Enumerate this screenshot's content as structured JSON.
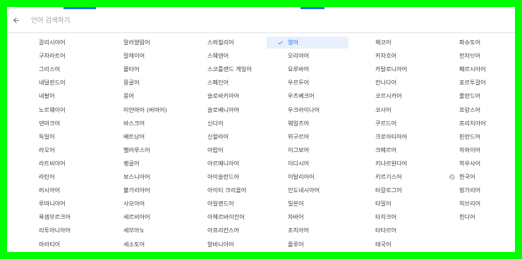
{
  "search": {
    "placeholder": "언어 검색하기"
  },
  "columns": [
    [
      "갈리시아어",
      "구자라트어",
      "그리스어",
      "네덜란드어",
      "네팔어",
      "노르웨이어",
      "덴마크어",
      "독일어",
      "라오어",
      "라트비아어",
      "라틴어",
      "러시아어",
      "루마니아어",
      "룩셈부르크어",
      "리투아니아어",
      "마라티어"
    ],
    [
      "말라얄람어",
      "말레이어",
      "몰타어",
      "몽골어",
      "몽어",
      "미얀마어 (버마어)",
      "바스크어",
      "베트남어",
      "벨라루스어",
      "벵골어",
      "보스니아어",
      "불가리아어",
      "사모아어",
      "세르비아어",
      "세부아노",
      "세소토어"
    ],
    [
      "스와힐리어",
      "스웨덴어",
      "스코틀랜드 게일어",
      "스페인어",
      "슬로바키아어",
      "슬로베니아어",
      "신디어",
      "신할라어",
      "아랍어",
      "아르메니아어",
      "아이슬란드어",
      "아이티 크리올어",
      "아일랜드어",
      "아제르바이잔어",
      "아프리칸스어",
      "알바니아어"
    ],
    [
      "영어",
      "오리야어",
      "요루바어",
      "우르두어",
      "우즈베크어",
      "우크라이나어",
      "웨일즈어",
      "위구르어",
      "이그보어",
      "이디시어",
      "이탈리아어",
      "인도네시아어",
      "일본어",
      "자바어",
      "조지아어",
      "줄루어"
    ],
    [
      "체코어",
      "카자흐어",
      "카탈로니아어",
      "칸나다어",
      "코르시카어",
      "코사어",
      "쿠르드어",
      "크로아티아어",
      "크메르어",
      "키냐르완다어",
      "키르기스어",
      "타갈로그어",
      "타밀어",
      "타지크어",
      "타타르어",
      "태국어"
    ],
    [
      "파슈토어",
      "펀자브어",
      "페르시아어",
      "포르투갈어",
      "폴란드어",
      "프랑스어",
      "프리지아어",
      "핀란드어",
      "하와이어",
      "하우사어",
      "한국어",
      "헝가리어",
      "히브리어",
      "힌디어"
    ]
  ],
  "selected": "영어",
  "recent": "한국어",
  "colors": {
    "accent": "#1a73e8",
    "selected_bg": "#e8f0fe",
    "frame": "#00ff00"
  },
  "icons": {
    "back": "arrow-left-icon",
    "selected": "check-icon",
    "recent": "history-icon"
  }
}
